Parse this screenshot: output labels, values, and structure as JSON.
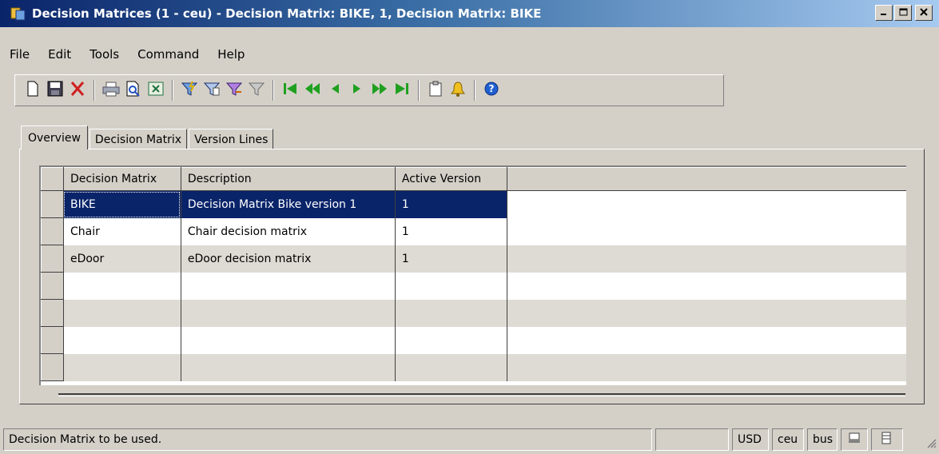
{
  "window": {
    "title": "Decision Matrices (1 - ceu) - Decision Matrix: BIKE, 1, Decision Matrix: BIKE",
    "buttons": {
      "minimize": "_",
      "maximize": "□",
      "close": "✕"
    }
  },
  "menu": [
    {
      "label": "File",
      "name": "menu-file"
    },
    {
      "label": "Edit",
      "name": "menu-edit"
    },
    {
      "label": "Tools",
      "name": "menu-tools"
    },
    {
      "label": "Command",
      "name": "menu-command"
    },
    {
      "label": "Help",
      "name": "menu-help"
    }
  ],
  "toolbar_icons": [
    "new-icon",
    "save-icon",
    "delete-icon",
    "print-icon",
    "print-preview-icon",
    "excel-export-icon",
    "filter-icon",
    "filter-by-selection-icon",
    "filter-advanced-icon",
    "remove-filter-icon",
    "first-record-icon",
    "previous-page-icon",
    "previous-record-icon",
    "next-record-icon",
    "next-page-icon",
    "last-record-icon",
    "document-handling-icon",
    "alert-icon",
    "help-icon"
  ],
  "tabs": [
    "Overview",
    "Decision Matrix",
    "Version Lines"
  ],
  "grid": {
    "columns": [
      "Decision Matrix",
      "Description",
      "Active Version"
    ],
    "rows": [
      [
        "BIKE",
        "Decision Matrix Bike version 1",
        "1"
      ],
      [
        "Chair",
        "Chair decision matrix",
        "1"
      ],
      [
        "eDoor",
        "eDoor decision matrix",
        "1"
      ],
      [
        "",
        "",
        ""
      ],
      [
        "",
        "",
        ""
      ],
      [
        "",
        "",
        ""
      ],
      [
        "",
        "",
        ""
      ]
    ],
    "selected_row": 0
  },
  "status": {
    "message": "Decision Matrix to be used.",
    "currency": "USD",
    "company": "ceu",
    "layer": "bus"
  },
  "colors": {
    "title_start": "#0a246a",
    "title_end": "#a6caf0",
    "selection": "#0a246a",
    "face": "#d4d0c8"
  }
}
